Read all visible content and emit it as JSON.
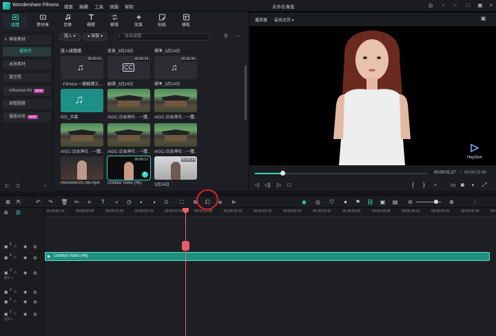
{
  "app": {
    "name": "Wondershare Filmora",
    "project": "未命名專案"
  },
  "menu": [
    "檔案",
    "編輯",
    "工具",
    "視圖",
    "幫助"
  ],
  "tabs": [
    {
      "label": "媒體",
      "icon": "media-icon",
      "active": true
    },
    {
      "label": "素材庫",
      "icon": "stock-icon"
    },
    {
      "label": "音樂",
      "icon": "music-icon"
    },
    {
      "label": "標題",
      "icon": "title-icon"
    },
    {
      "label": "轉場",
      "icon": "transition-icon"
    },
    {
      "label": "效果",
      "icon": "effects-icon"
    },
    {
      "label": "貼紙",
      "icon": "sticker-icon"
    },
    {
      "label": "模板",
      "icon": "template-icon"
    }
  ],
  "sidebar": {
    "items": [
      {
        "label": "專案素材"
      },
      {
        "label": "檔案夾",
        "sub": true
      },
      {
        "label": "本地素材"
      },
      {
        "label": "雲空間"
      },
      {
        "label": "Influence Kit",
        "badge": "NEW"
      },
      {
        "label": "調整圖層"
      },
      {
        "label": "優惠共用",
        "badge": "NEW"
      }
    ]
  },
  "library": {
    "import_label": "匯入",
    "record_label": "錄製",
    "search_placeholder": "搜尋媒體",
    "folders": [
      "匯入媒體櫃",
      "背景_3月24日",
      "標準_3月24日"
    ],
    "items": [
      {
        "caption": "- Filmora 一鍵翻譯文...",
        "duration": "00:00:03"
      },
      {
        "caption": "翻譯_3月24日",
        "duration": "00:00:34"
      },
      {
        "caption": "標準_3月24日",
        "duration": "00:00:34"
      },
      {
        "caption": "002_字幕",
        "duration": ""
      },
      {
        "caption": "AIGC-日本神社 - 一體...",
        "duration": ""
      },
      {
        "caption": "AIGC-日本神社 - 一體...",
        "duration": ""
      },
      {
        "caption": "AIGC-日本神社 - 一體...",
        "duration": ""
      },
      {
        "caption": "AIGC-日本神社 - 一體...",
        "duration": ""
      },
      {
        "caption": "AIGC-日本神社 - 一體...",
        "duration": ""
      },
      {
        "caption": "0600856025789.mp4",
        "duration": ""
      },
      {
        "caption": "Untitled Video (46)",
        "duration": "00:00:12"
      },
      {
        "caption": "3月24日",
        "duration": "00:00:34"
      }
    ]
  },
  "preview": {
    "label": "播放器",
    "quality": "最高品質",
    "watermark": "HeyGen",
    "current_time": "00:00:01:27",
    "total_time": "00:00:12:06",
    "progress": 0.16
  },
  "timeline": {
    "ticks": [
      "00:00:00:10",
      "00:00:00:20",
      "00:00:01:00",
      "00:00:01:10",
      "00:00:01:20",
      "00:00:02:00",
      "00:00:02:10",
      "00:00:02:20",
      "00:00:03:00",
      "00:00:03:10",
      "00:00:03:20",
      "00:00:04:00",
      "00:00:04:10",
      "00:00:04:20",
      "00:00:05:00",
      "00:00:05:10"
    ],
    "clip_label": "Untitled Video (46)",
    "tracks": [
      {
        "label": "影片 4"
      },
      {
        "label": "影片 3"
      },
      {
        "label": "影片 2"
      },
      {
        "label": "影片 1"
      },
      {
        "label": "音訊 1"
      }
    ],
    "track_numbers": [
      "5",
      "4",
      "3",
      "2",
      "1"
    ]
  },
  "colors": {
    "accent": "#32d9c2",
    "clip": "#1f8f80",
    "playhead": "#ff5a6b",
    "annotation": "#e2202c"
  }
}
